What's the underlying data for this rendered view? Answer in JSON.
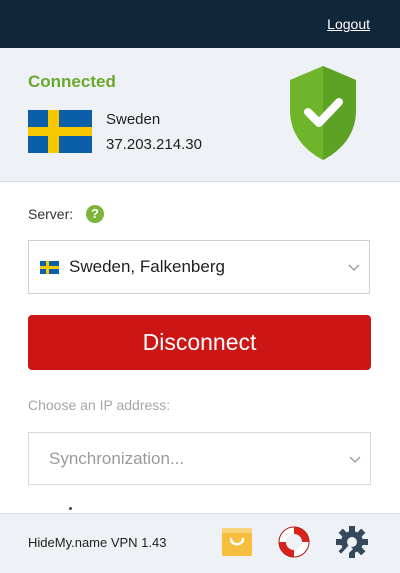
{
  "header": {
    "logout_label": "Logout"
  },
  "status": {
    "connected_label": "Connected",
    "country": "Sweden",
    "ip": "37.203.214.30"
  },
  "server": {
    "label": "Server:",
    "help_symbol": "?",
    "selected": "Sweden, Falkenberg"
  },
  "action": {
    "disconnect_label": "Disconnect"
  },
  "ip_choice": {
    "label": "Choose an IP address:",
    "selected": "Synchronization..."
  },
  "footer": {
    "version": "HideMy.name VPN 1.43",
    "icons": [
      "shop-bag-icon",
      "lifebuoy-icon",
      "settings-gear-icon"
    ]
  },
  "colors": {
    "topbar": "#10263b",
    "accent_green": "#6aa82d",
    "disconnect_red": "#cc1515",
    "flag_blue": "#0a5fa8",
    "flag_yellow": "#f7c800"
  }
}
